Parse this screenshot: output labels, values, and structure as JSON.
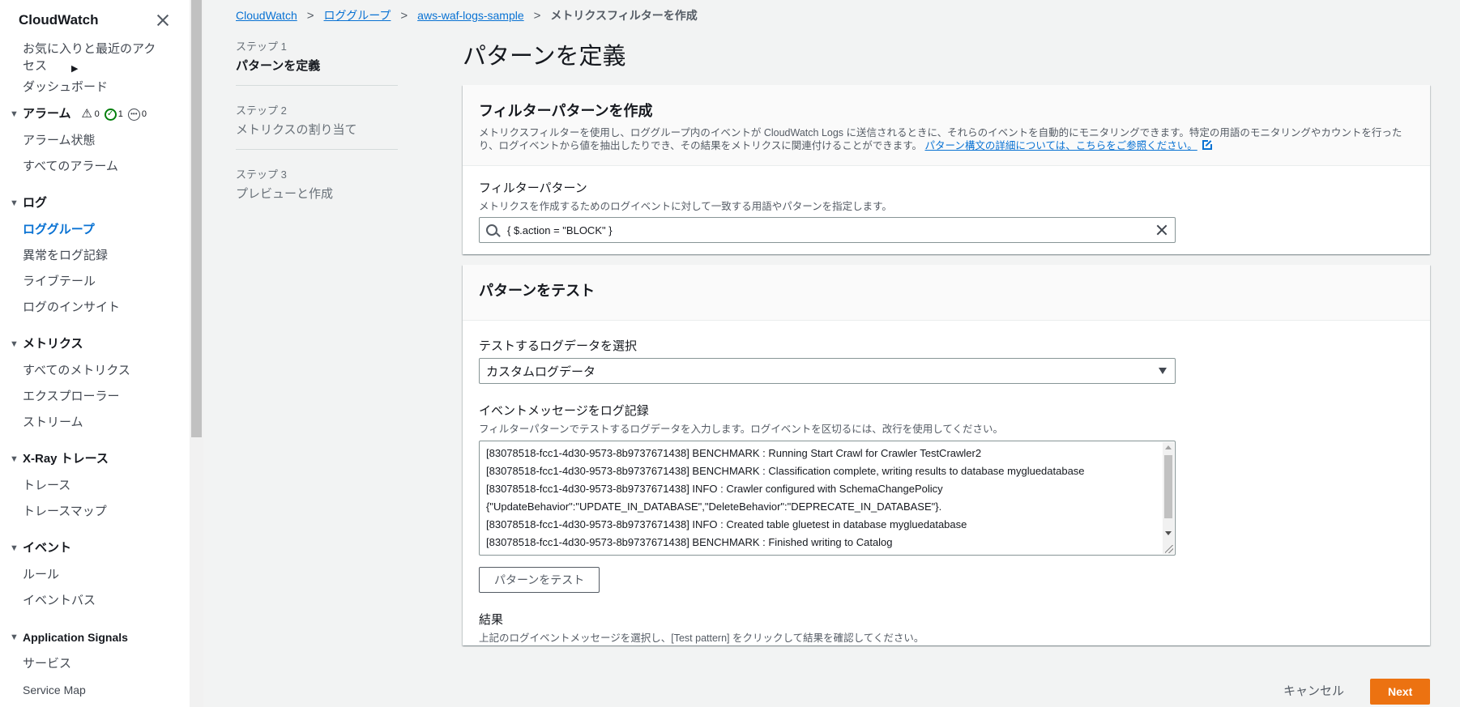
{
  "sidebar": {
    "title": "CloudWatch",
    "favorites": "お気に入りと最近のアクセス",
    "dashboard": "ダッシュボード",
    "sections": {
      "alarms": {
        "label": "アラーム",
        "count_alarm": "0",
        "count_ok": "1",
        "count_insufficient": "0",
        "items": [
          "アラーム状態",
          "すべてのアラーム"
        ]
      },
      "logs": {
        "label": "ログ",
        "items": [
          "ロググループ",
          "異常をログ記録",
          "ライブテール",
          "ログのインサイト"
        ]
      },
      "metrics": {
        "label": "メトリクス",
        "items": [
          "すべてのメトリクス",
          "エクスプローラー",
          "ストリーム"
        ]
      },
      "xray": {
        "label": "X-Ray トレース",
        "items": [
          "トレース",
          "トレースマップ"
        ]
      },
      "events": {
        "label": "イベント",
        "items": [
          "ルール",
          "イベントバス"
        ]
      },
      "appsignals": {
        "label": "Application Signals",
        "items": [
          "サービス",
          "Service Map"
        ]
      }
    }
  },
  "breadcrumb": {
    "items": [
      "CloudWatch",
      "ロググループ",
      "aws-waf-logs-sample"
    ],
    "current": "メトリクスフィルターを作成"
  },
  "steps": [
    {
      "num": "ステップ 1",
      "name": "パターンを定義"
    },
    {
      "num": "ステップ 2",
      "name": "メトリクスの割り当て"
    },
    {
      "num": "ステップ 3",
      "name": "プレビューと作成"
    }
  ],
  "page_title": "パターンを定義",
  "filter_panel": {
    "title": "フィルターパターンを作成",
    "description": "メトリクスフィルターを使用し、ロググループ内のイベントが CloudWatch Logs に送信されるときに、それらのイベントを自動的にモニタリングできます。特定の用語のモニタリングやカウントを行ったり、ログイベントから値を抽出したりでき、その結果をメトリクスに関連付けることができます。",
    "link": "パターン構文の詳細については、こちらをご参照ください。",
    "field_label": "フィルターパターン",
    "field_desc": "メトリクスを作成するためのログイベントに対して一致する用語やパターンを指定します。",
    "value": "{ $.action = \"BLOCK\" }"
  },
  "test_panel": {
    "title": "パターンをテスト",
    "select_label": "テストするログデータを選択",
    "select_value": "カスタムログデータ",
    "events_label": "イベントメッセージをログ記録",
    "events_desc": "フィルターパターンでテストするログデータを入力します。ログイベントを区切るには、改行を使用してください。",
    "log_lines": [
      "[83078518-fcc1-4d30-9573-8b9737671438] BENCHMARK : Running Start Crawl for Crawler TestCrawler2",
      "[83078518-fcc1-4d30-9573-8b9737671438] BENCHMARK : Classification complete, writing results to database mygluedatabase",
      "[83078518-fcc1-4d30-9573-8b9737671438] INFO : Crawler configured with SchemaChangePolicy",
      "{\"UpdateBehavior\":\"UPDATE_IN_DATABASE\",\"DeleteBehavior\":\"DEPRECATE_IN_DATABASE\"}.",
      "[83078518-fcc1-4d30-9573-8b9737671438] INFO : Created table gluetest in database mygluedatabase",
      "[83078518-fcc1-4d30-9573-8b9737671438] BENCHMARK : Finished writing to Catalog"
    ],
    "test_button": "パターンをテスト",
    "result_label": "結果",
    "result_desc": "上記のログイベントメッセージを選択し、[Test pattern] をクリックして結果を確認してください。"
  },
  "footer": {
    "cancel": "キャンセル",
    "next": "Next"
  },
  "colors": {
    "accent": "#0972d3",
    "primary_button": "#ec7211",
    "ok": "#037f0c"
  }
}
